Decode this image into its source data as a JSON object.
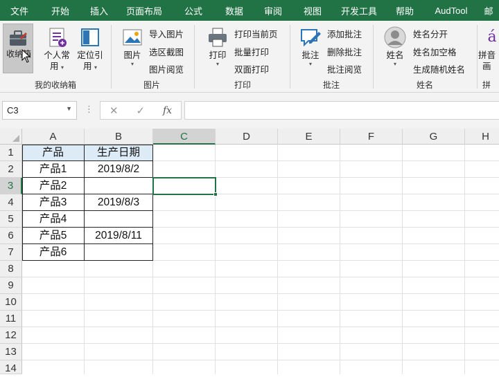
{
  "menu": [
    "文件",
    "开始",
    "插入",
    "页面布局",
    "公式",
    "数据",
    "审阅",
    "视图",
    "开发工具",
    "帮助",
    "AudTool",
    "邮"
  ],
  "ribbon": {
    "group1": {
      "label": "我的收纳箱",
      "btn1": "收纳箱",
      "btn2_line1": "个人常",
      "btn2_line2": "用",
      "btn3_line1": "定位引",
      "btn3_line2": "用"
    },
    "group2": {
      "label": "图片",
      "big": "图片",
      "items": [
        "导入图片",
        "选区截图",
        "图片阅览"
      ]
    },
    "group3": {
      "label": "打印",
      "big": "打印",
      "items": [
        "打印当前页",
        "批量打印",
        "双面打印"
      ]
    },
    "group4": {
      "label": "批注",
      "big": "批注",
      "items": [
        "添加批注",
        "删除批注",
        "批注阅览"
      ]
    },
    "group5": {
      "label": "姓名",
      "big": "姓名",
      "items": [
        "姓名分开",
        "姓名加空格",
        "生成随机姓名"
      ]
    },
    "group6": {
      "label": "拼",
      "big_line1": "拼音",
      "big_line2": "画"
    }
  },
  "formula_bar": {
    "name_box": "C3",
    "cancel": "✕",
    "enter": "✓",
    "fx": "fx",
    "value": ""
  },
  "columns": [
    "A",
    "B",
    "C",
    "D",
    "E",
    "F",
    "G",
    "H"
  ],
  "rows": [
    "1",
    "2",
    "3",
    "4",
    "5",
    "6",
    "7",
    "8",
    "9",
    "10",
    "11",
    "12",
    "13",
    "14"
  ],
  "selected_cell": "C3",
  "cells": {
    "A1": "产品",
    "B1": "生产日期",
    "A2": "产品1",
    "B2": "2019/8/2",
    "A3": "产品2",
    "B3": "",
    "A4": "产品3",
    "B4": "2019/8/3",
    "A5": "产品4",
    "B5": "",
    "A6": "产品5",
    "B6": "2019/8/11",
    "A7": "产品6",
    "B7": ""
  },
  "colors": {
    "accent": "#217346",
    "header_fill": "#ddebf7"
  }
}
